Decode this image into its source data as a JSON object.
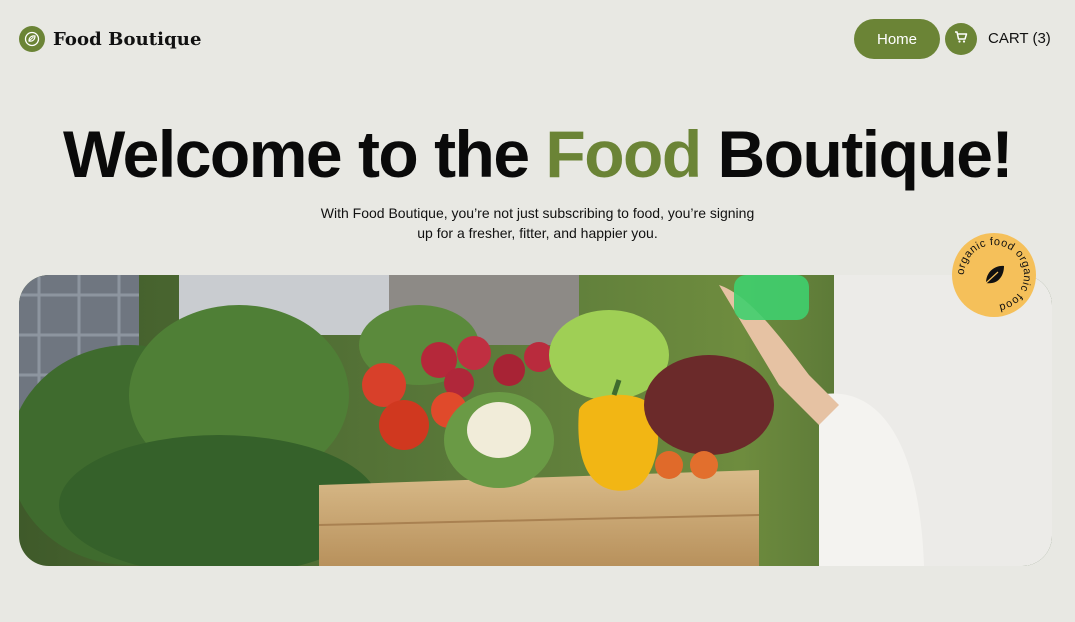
{
  "brand": {
    "name": "Food Boutique",
    "logo_icon": "leaf-logo-icon"
  },
  "nav": {
    "home_label": "Home",
    "cart_icon": "cart-icon",
    "cart_label": "CART (3)"
  },
  "hero": {
    "title_before": "Welcome to the ",
    "title_accent": "Food",
    "title_after": " Boutique!",
    "subtitle": "With Food Boutique, you’re not just subscribing to food, you’re signing up for a fresher, fitter, and happier you.",
    "image_icon": "vegetable-crate-photo"
  },
  "badge": {
    "text": "organic food organic food",
    "icon": "leaf-icon"
  },
  "colors": {
    "accent": "#6b8436",
    "background": "#e8e8e3",
    "badge": "#f5c05a"
  }
}
